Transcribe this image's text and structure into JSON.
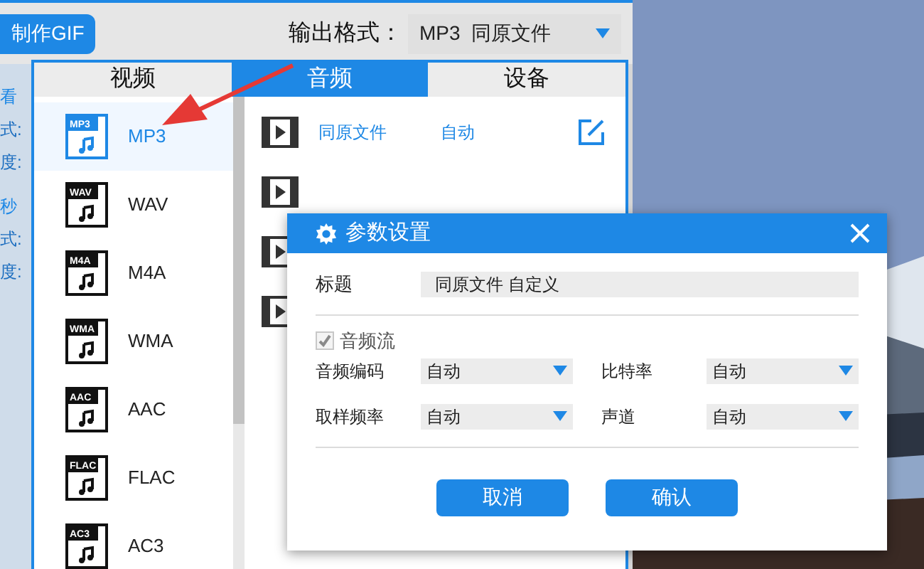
{
  "toolbar": {
    "gif_button": "制作GIF",
    "output_label": "输出格式：",
    "output_value": "MP3  同原文件"
  },
  "side_labels": [
    {
      "text": "看",
      "kind": "link"
    },
    {
      "text": "式:",
      "kind": "text"
    },
    {
      "text": "度:",
      "kind": "text"
    },
    {
      "text": "秒",
      "kind": "link"
    },
    {
      "text": "式:",
      "kind": "text"
    },
    {
      "text": "度:",
      "kind": "text"
    }
  ],
  "tabs": [
    {
      "label": "视频",
      "selected": false
    },
    {
      "label": "音频",
      "selected": true
    },
    {
      "label": "设备",
      "selected": false
    }
  ],
  "formats": [
    {
      "badge": "MP3",
      "label": "MP3",
      "selected": true
    },
    {
      "badge": "WAV",
      "label": "WAV",
      "selected": false
    },
    {
      "badge": "M4A",
      "label": "M4A",
      "selected": false
    },
    {
      "badge": "WMA",
      "label": "WMA",
      "selected": false
    },
    {
      "badge": "AAC",
      "label": "AAC",
      "selected": false
    },
    {
      "badge": "FLAC",
      "label": "FLAC",
      "selected": false
    },
    {
      "badge": "AC3",
      "label": "AC3",
      "selected": false
    }
  ],
  "presets": [
    {
      "kind": "full",
      "name": "同原文件",
      "value": "自动"
    },
    {
      "kind": "icon_only"
    },
    {
      "kind": "icon_only"
    },
    {
      "kind": "icon_only"
    }
  ],
  "dialog": {
    "title": "参数设置",
    "title_label": "标题",
    "title_value": "同原文件 自定义",
    "stream": {
      "label": "音频流",
      "checked": true,
      "disabled": true
    },
    "selects": [
      {
        "label": "音频编码",
        "value": "自动"
      },
      {
        "label": "比特率",
        "value": "自动"
      },
      {
        "label": "取样频率",
        "value": "自动"
      },
      {
        "label": "声道",
        "value": "自动"
      }
    ],
    "buttons": [
      "取消",
      "确认"
    ]
  }
}
